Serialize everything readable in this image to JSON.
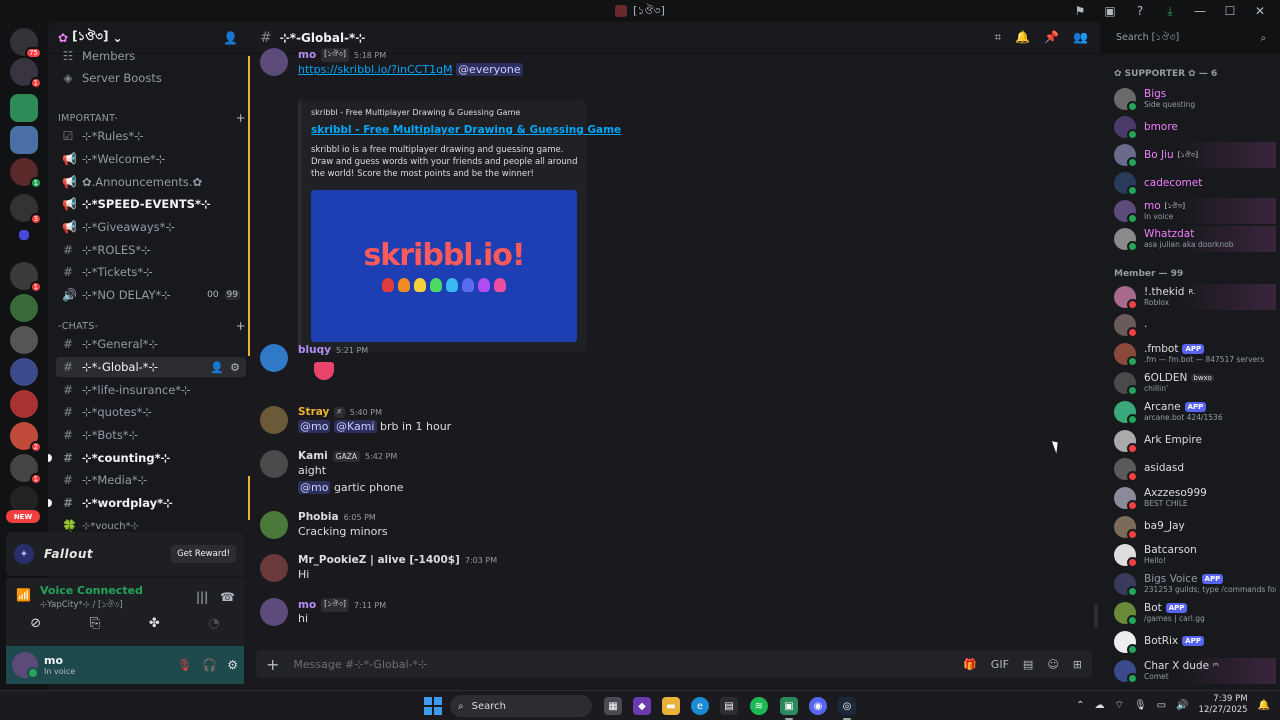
{
  "window": {
    "title": "[১ঔ৩]"
  },
  "server": {
    "name": "[১ঔ৩]"
  },
  "rail": {
    "badges": [
      "75",
      "1",
      "1",
      "3",
      "1",
      "2",
      "1"
    ],
    "new_label": "NEW"
  },
  "channels": {
    "top_items": [
      {
        "label": "Members",
        "icon": "members-icon"
      },
      {
        "label": "Server Boosts",
        "icon": "boost-icon"
      }
    ],
    "categories": [
      {
        "label": "IMPORTANT-"
      },
      {
        "label": "-CHATS-"
      }
    ],
    "important": [
      {
        "label": "⊹*Rules*⊹",
        "icon": "rules-icon",
        "bold": false
      },
      {
        "label": "⊹*Welcome*⊹",
        "icon": "announce-icon",
        "bold": false
      },
      {
        "label": "✿.Announcements.✿",
        "icon": "announce-icon",
        "bold": false
      },
      {
        "label": "⊹*SPEED-EVENTS*⊹",
        "icon": "announce-icon",
        "bold": true
      },
      {
        "label": "⊹*Giveaways*⊹",
        "icon": "announce-icon",
        "bold": false
      },
      {
        "label": "⊹*ROLES*⊹",
        "icon": "hash-icon",
        "bold": false
      },
      {
        "label": "⊹*Tickets*⊹",
        "icon": "hash-icon",
        "bold": false
      },
      {
        "label": "⊹*NO DELAY*⊹",
        "icon": "speaker-icon",
        "bold": false,
        "tail": [
          "00",
          "99"
        ]
      }
    ],
    "chats": [
      {
        "label": "⊹*General*⊹",
        "bold": false
      },
      {
        "label": "⊹*-Global-*⊹",
        "bold": false,
        "active": true
      },
      {
        "label": "⊹*life-insurance*⊹",
        "bold": false
      },
      {
        "label": "⊹*quotes*⊹",
        "bold": false
      },
      {
        "label": "⊹*Bots*⊹",
        "bold": false
      },
      {
        "label": "⊹*counting*⊹",
        "bold": true
      },
      {
        "label": "⊹*Media*⊹",
        "bold": false
      },
      {
        "label": "⊹*wordplay*⊹",
        "bold": true
      },
      {
        "label": "⊹*vouch*⊹",
        "bold": false
      }
    ]
  },
  "promo": {
    "brand": "Fallout",
    "button": "Get Reward!"
  },
  "voice": {
    "title": "Voice Connected",
    "subtitle": "⊹YapCity*⊹ / [১ঔ৩]"
  },
  "user": {
    "name": "mo",
    "status": "In voice"
  },
  "chat": {
    "channel": "⊹*-Global-*⊹",
    "composer_placeholder": "Message #⊹*-Global-*⊹",
    "messages": [
      {
        "author": "mo",
        "tag": "[১ঔ৩]",
        "time": "5:18 PM",
        "color": "#b38cf5",
        "lines": [
          "https://skribbl.io/?inCCT1gM",
          "@everyone"
        ]
      },
      {
        "author": "bluqy",
        "time": "5:21 PM",
        "color": "#b38cf5"
      },
      {
        "author": "Stray",
        "tag": "ᴶᴱ",
        "time": "5:40 PM",
        "color": "#f0b232",
        "lines": [
          "@mo",
          "@Kami",
          "brb in 1 hour"
        ]
      },
      {
        "author": "Kami",
        "tag": "GAZA",
        "time": "5:42 PM",
        "color": "#dbdee1",
        "lines": [
          "aight",
          "@mo",
          "gartic phone"
        ]
      },
      {
        "author": "Phobia",
        "time": "6:05 PM",
        "color": "#dbdee1",
        "lines": [
          "Cracking minors"
        ]
      },
      {
        "author": "Mr_PookieZ | alive [-1400$]",
        "time": "7:03 PM",
        "color": "#dbdee1",
        "lines": [
          "Hi"
        ]
      },
      {
        "author": "mo",
        "tag": "[১ঔ৩]",
        "time": "7:11 PM",
        "color": "#b38cf5",
        "lines": [
          "hi"
        ]
      }
    ],
    "embed": {
      "provider": "skribbl - Free Multiplayer Drawing & Guessing Game",
      "title": "skribbl - Free Multiplayer Drawing & Guessing Game",
      "description": "skribbl io is a free multiplayer drawing and guessing game. Draw and guess words with your friends and people all around the world! Score the most points and be the winner!",
      "image_text": "skribbl.io!"
    }
  },
  "members": {
    "search_placeholder": "Search [১ঔ৩]",
    "groups": [
      {
        "label": "✿ SUPPORTER ✿ — 6"
      },
      {
        "label": "Member — 99"
      }
    ],
    "supporters": [
      {
        "name": "Bigs",
        "status": "Side questing",
        "color": "#f47fff"
      },
      {
        "name": "bmore",
        "status": "",
        "color": "#f47fff"
      },
      {
        "name": "Bo Jiu",
        "tag": "[১ঔ৩]",
        "status": "",
        "color": "#f47fff"
      },
      {
        "name": "cadecomet",
        "status": "",
        "color": "#f47fff"
      },
      {
        "name": "mo",
        "tag": "[১ঔ৩]",
        "status": "In voice",
        "color": "#f47fff"
      },
      {
        "name": "Whatzdat",
        "status": "asa julian aka doorknob",
        "color": "#f47fff"
      }
    ],
    "members": [
      {
        "name": "!.thekid",
        "tag": "R.",
        "status": "Roblox",
        "color": "#dbdee1"
      },
      {
        "name": ".",
        "status": "",
        "color": "#dbdee1"
      },
      {
        "name": ".fmbot",
        "app": "APP",
        "status": ".fm — fm.bot — 847517 servers",
        "color": "#dbdee1"
      },
      {
        "name": "6OLDEN",
        "tag": "bwxo",
        "status": "chillin'",
        "color": "#dbdee1"
      },
      {
        "name": "Arcane",
        "app": "APP",
        "status": "arcane.bot 424/1536",
        "color": "#dbdee1"
      },
      {
        "name": "Ark Empire",
        "status": "",
        "color": "#dbdee1"
      },
      {
        "name": "asidasd",
        "status": "",
        "color": "#dbdee1"
      },
      {
        "name": "Axzzeso999",
        "status": "BEST CHILE",
        "color": "#dbdee1"
      },
      {
        "name": "ba9_Jay",
        "status": "",
        "color": "#dbdee1"
      },
      {
        "name": "Batcarson",
        "status": "Hello!",
        "color": "#dbdee1"
      },
      {
        "name": "Bigs Voice",
        "app": "APP",
        "status": "231253 guilds; type /commands for c",
        "color": "#949ba4"
      },
      {
        "name": "Bot",
        "app": "APP",
        "status": "/games | carl.gg",
        "color": "#dbdee1"
      },
      {
        "name": "BotRix",
        "app": "APP",
        "status": "",
        "color": "#dbdee1"
      },
      {
        "name": "Char X dude",
        "tag": "ᴶᴾᴸ",
        "status": "Comet",
        "color": "#dbdee1"
      }
    ]
  },
  "taskbar": {
    "search": "Search",
    "time": "7:39 PM",
    "date": "12/27/2025"
  }
}
